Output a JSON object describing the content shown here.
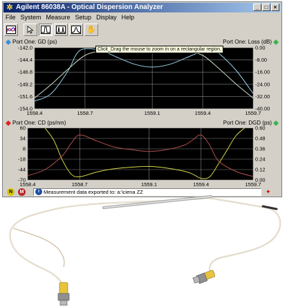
{
  "window": {
    "title": "Agilent 86038A - Optical Dispersion Analyzer",
    "controls": [
      "_",
      "□",
      "×"
    ]
  },
  "menu": [
    "File",
    "System",
    "Measure",
    "Setup",
    "Display",
    "Help"
  ],
  "toolbar": {
    "buttons": [
      "overview-icon",
      "pointer-icon",
      "single-peak-icon",
      "dual-peak-icon",
      "shaped-peak-icon",
      "hand-icon"
    ]
  },
  "tooltip": "Click_Drag the mouse to zoom in on a rectangular region.",
  "top_pane": {
    "left_label": "Port One: GD (ps)",
    "right_label": "Port One: Loss (dB)",
    "left_marker_color": "#3a8fd8",
    "right_marker_color": "#39b54a"
  },
  "bottom_pane": {
    "left_label": "Port One: CD (ps/nm)",
    "right_label": "Port One: DGD (ps)",
    "left_marker_color": "#d8261d",
    "right_marker_color": "#39b54a"
  },
  "status": {
    "n_label": "N",
    "m_label": "M",
    "info_label": "i",
    "message": "Measurement data exported to: a:\\ciena ZZ",
    "brand": "✦"
  },
  "chart_data": [
    {
      "type": "line",
      "x_ticks": [
        1558.4,
        1558.7,
        1559.1,
        1559.4,
        1559.7
      ],
      "left_axis": {
        "label": "Port One: GD (ps)",
        "ticks": [
          -142.0,
          -144.4,
          -146.8,
          -149.2,
          -151.6,
          -154.0
        ],
        "range": [
          -154.0,
          -142.0
        ]
      },
      "right_axis": {
        "label": "Port One: Loss (dB)",
        "ticks": [
          0.0,
          -8.0,
          -16.0,
          -24.0,
          -32.0,
          -40.0
        ],
        "range": [
          -40.0,
          0.0
        ]
      },
      "xlim": [
        1558.4,
        1559.7
      ],
      "grid": true,
      "series": [
        {
          "color": "#9ad3e8",
          "axis": "left",
          "x": [
            1558.4,
            1558.5,
            1558.6,
            1558.65,
            1558.7,
            1558.8,
            1558.9,
            1559.0,
            1559.1,
            1559.2,
            1559.3,
            1559.4,
            1559.45,
            1559.5,
            1559.6,
            1559.7
          ],
          "y": [
            -152.5,
            -151.0,
            -146.5,
            -143.2,
            -142.2,
            -142.6,
            -144.0,
            -145.3,
            -145.8,
            -145.3,
            -144.0,
            -142.6,
            -142.2,
            -143.2,
            -146.5,
            -151.0
          ]
        },
        {
          "color": "#c8dcc8",
          "axis": "right",
          "x": [
            1558.4,
            1558.5,
            1558.6,
            1558.7,
            1558.8,
            1558.9,
            1559.0,
            1559.1,
            1559.2,
            1559.3,
            1559.4,
            1559.5,
            1559.6,
            1559.7
          ],
          "y": [
            -33.0,
            -24.0,
            -14.0,
            -5.0,
            -2.0,
            -1.5,
            -1.6,
            -1.6,
            -1.5,
            -2.0,
            -5.0,
            -14.0,
            -24.0,
            -33.0
          ]
        }
      ]
    },
    {
      "type": "line",
      "x_ticks": [
        1558.4,
        1558.7,
        1559.1,
        1559.4,
        1559.7
      ],
      "left_axis": {
        "label": "Port One: CD (ps/nm)",
        "ticks": [
          60,
          34,
          8,
          -18,
          -44,
          -70
        ],
        "range": [
          -70,
          60
        ]
      },
      "right_axis": {
        "label": "Port One: DGD (ps)",
        "ticks": [
          0.6,
          0.48,
          0.36,
          0.24,
          0.12,
          0.0
        ],
        "range": [
          0.0,
          0.6
        ]
      },
      "xlim": [
        1558.4,
        1559.7
      ],
      "grid": true,
      "series": [
        {
          "color": "#d8d84a",
          "axis": "left",
          "x": [
            1558.5,
            1558.55,
            1558.6,
            1558.65,
            1558.7,
            1558.8,
            1558.9,
            1559.0,
            1559.1,
            1559.2,
            1559.3,
            1559.35,
            1559.4,
            1559.45,
            1559.5,
            1559.55,
            1559.6,
            1559.65
          ],
          "y": [
            60,
            30,
            -20,
            -55,
            -62,
            -50,
            -42,
            -38,
            -36,
            -40,
            -48,
            -55,
            -66,
            -62,
            -30,
            5,
            40,
            60
          ]
        },
        {
          "color": "#b05050",
          "axis": "right",
          "x": [
            1558.4,
            1558.5,
            1558.6,
            1558.65,
            1558.7,
            1558.8,
            1558.9,
            1559.0,
            1559.1,
            1559.2,
            1559.3,
            1559.35,
            1559.4,
            1559.45,
            1559.5,
            1559.6,
            1559.7
          ],
          "y": [
            0.05,
            0.12,
            0.28,
            0.42,
            0.52,
            0.45,
            0.38,
            0.35,
            0.33,
            0.35,
            0.4,
            0.46,
            0.52,
            0.4,
            0.22,
            0.1,
            0.04
          ]
        }
      ]
    }
  ]
}
